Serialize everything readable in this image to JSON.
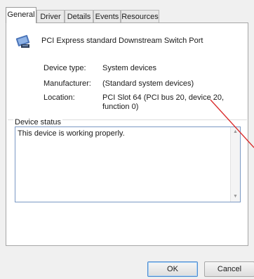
{
  "tabs": [
    "General",
    "Driver",
    "Details",
    "Events",
    "Resources"
  ],
  "device_name": "PCI Express standard Downstream Switch Port",
  "properties": [
    {
      "label": "Device type:",
      "value": "System devices"
    },
    {
      "label": "Manufacturer:",
      "value": "(Standard system devices)"
    },
    {
      "label": "Location:",
      "value": "PCI Slot 64 (PCI bus 20, device 20, function 0)"
    }
  ],
  "device_status": {
    "title": "Device status",
    "text": "This device is working properly."
  },
  "buttons": {
    "ok": "OK",
    "cancel": "Cancel"
  },
  "annotation": {
    "color": "#d92a2a"
  }
}
